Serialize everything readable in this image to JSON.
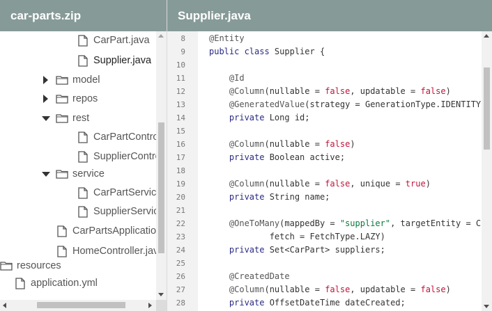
{
  "left_pane": {
    "title": "car-parts.zip",
    "tree": [
      {
        "label": "CarPart.java",
        "type": "file"
      },
      {
        "label": "Supplier.java",
        "type": "file",
        "selected": true
      },
      {
        "label": "model",
        "type": "folder",
        "expanded": false
      },
      {
        "label": "repos",
        "type": "folder",
        "expanded": false
      },
      {
        "label": "rest",
        "type": "folder",
        "expanded": true
      },
      {
        "label": "CarPartController.java",
        "type": "file"
      },
      {
        "label": "SupplierController.java",
        "type": "file"
      },
      {
        "label": "service",
        "type": "folder",
        "expanded": true
      },
      {
        "label": "CarPartService.java",
        "type": "file"
      },
      {
        "label": "SupplierService.java",
        "type": "file"
      },
      {
        "label": "CarPartsApplication.java",
        "type": "file"
      },
      {
        "label": "HomeController.java",
        "type": "file"
      },
      {
        "label": "resources",
        "type": "folder",
        "expanded": true
      },
      {
        "label": "application.yml",
        "type": "file"
      }
    ]
  },
  "editor": {
    "title": "Supplier.java",
    "line_numbers": [
      "8",
      "9",
      "10",
      "11",
      "12",
      "13",
      "14",
      "15",
      "16",
      "17",
      "18",
      "19",
      "20",
      "21",
      "22",
      "23",
      "24",
      "25",
      "26",
      "27",
      "28"
    ],
    "lines": [
      [
        {
          "t": "@Entity",
          "k": "annotation"
        }
      ],
      [
        {
          "t": "public class ",
          "k": "keyword"
        },
        {
          "t": "Supplier {",
          "k": "plain"
        }
      ],
      [],
      [
        {
          "t": "    @Id",
          "k": "annotation"
        }
      ],
      [
        {
          "t": "    @Column",
          "k": "annotation"
        },
        {
          "t": "(nullable = ",
          "k": "plain"
        },
        {
          "t": "false",
          "k": "literal"
        },
        {
          "t": ", updatable = ",
          "k": "plain"
        },
        {
          "t": "false",
          "k": "literal"
        },
        {
          "t": ")",
          "k": "plain"
        }
      ],
      [
        {
          "t": "    @GeneratedValue",
          "k": "annotation"
        },
        {
          "t": "(strategy = GenerationType.IDENTITY)",
          "k": "plain"
        }
      ],
      [
        {
          "t": "    private ",
          "k": "keyword"
        },
        {
          "t": "Long id;",
          "k": "plain"
        }
      ],
      [],
      [
        {
          "t": "    @Column",
          "k": "annotation"
        },
        {
          "t": "(nullable = ",
          "k": "plain"
        },
        {
          "t": "false",
          "k": "literal"
        },
        {
          "t": ")",
          "k": "plain"
        }
      ],
      [
        {
          "t": "    private ",
          "k": "keyword"
        },
        {
          "t": "Boolean active;",
          "k": "plain"
        }
      ],
      [],
      [
        {
          "t": "    @Column",
          "k": "annotation"
        },
        {
          "t": "(nullable = ",
          "k": "plain"
        },
        {
          "t": "false",
          "k": "literal"
        },
        {
          "t": ", unique = ",
          "k": "plain"
        },
        {
          "t": "true",
          "k": "literal"
        },
        {
          "t": ")",
          "k": "plain"
        }
      ],
      [
        {
          "t": "    private ",
          "k": "keyword"
        },
        {
          "t": "String name;",
          "k": "plain"
        }
      ],
      [],
      [
        {
          "t": "    @OneToMany",
          "k": "annotation"
        },
        {
          "t": "(mappedBy = ",
          "k": "plain"
        },
        {
          "t": "\"supplier\"",
          "k": "string"
        },
        {
          "t": ", targetEntity = CarPart.class,",
          "k": "plain"
        }
      ],
      [
        {
          "t": "            fetch = FetchType.LAZY)",
          "k": "plain"
        }
      ],
      [
        {
          "t": "    private ",
          "k": "keyword"
        },
        {
          "t": "Set<CarPart> suppliers;",
          "k": "plain"
        }
      ],
      [],
      [
        {
          "t": "    @CreatedDate",
          "k": "annotation"
        }
      ],
      [
        {
          "t": "    @Column",
          "k": "annotation"
        },
        {
          "t": "(nullable = ",
          "k": "plain"
        },
        {
          "t": "false",
          "k": "literal"
        },
        {
          "t": ", updatable = ",
          "k": "plain"
        },
        {
          "t": "false",
          "k": "literal"
        },
        {
          "t": ")",
          "k": "plain"
        }
      ],
      [
        {
          "t": "    private ",
          "k": "keyword"
        },
        {
          "t": "OffsetDateTime dateCreated;",
          "k": "plain"
        }
      ]
    ]
  }
}
